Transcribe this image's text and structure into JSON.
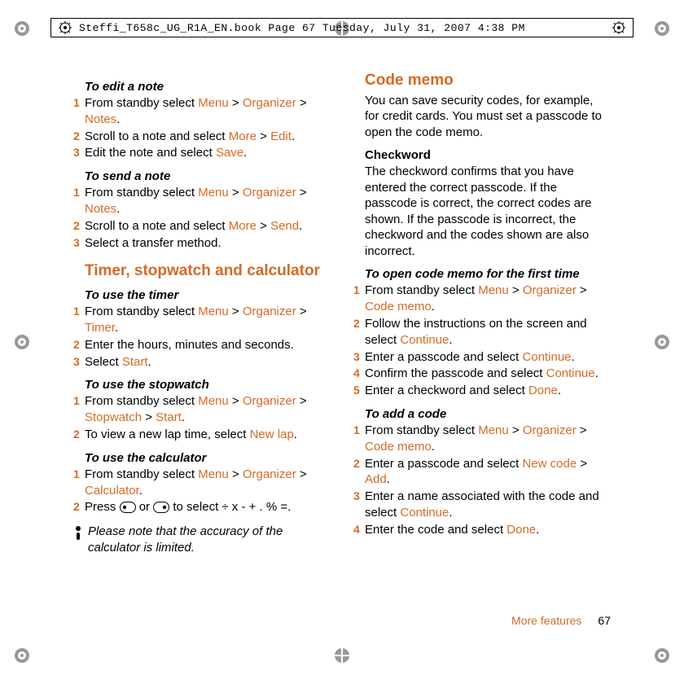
{
  "header": {
    "text": "Steffi_T658c_UG_R1A_EN.book  Page 67  Tuesday, July 31, 2007  4:38 PM"
  },
  "left": {
    "edit_note": {
      "title": "To edit a note",
      "s1a": "From standby select ",
      "s1_menu": "Menu",
      "s1_gt1": " > ",
      "s1_org": "Organizer",
      "s1_gt2": " > ",
      "s1_notes": "Notes",
      "s1_dot": ".",
      "s2a": "Scroll to a note and select ",
      "s2_more": "More",
      "s2_gt": " > ",
      "s2_edit": "Edit",
      "s2_dot": ".",
      "s3a": "Edit the note and select ",
      "s3_save": "Save",
      "s3_dot": "."
    },
    "send_note": {
      "title": "To send a note",
      "s1a": "From standby select ",
      "s1_menu": "Menu",
      "s1_gt1": " > ",
      "s1_org": "Organizer",
      "s1_gt2": " > ",
      "s1_notes": "Notes",
      "s1_dot": ".",
      "s2a": "Scroll to a note and select ",
      "s2_more": "More",
      "s2_gt": " > ",
      "s2_send": "Send",
      "s2_dot": ".",
      "s3": "Select a transfer method."
    },
    "section_tsc": "Timer, stopwatch and calculator",
    "timer": {
      "title": "To use the timer",
      "s1a": "From standby select ",
      "s1_menu": "Menu",
      "s1_gt1": " > ",
      "s1_org": "Organizer",
      "s1_gt2": " > ",
      "s1_timer": "Timer",
      "s1_dot": ".",
      "s2": "Enter the hours, minutes and seconds.",
      "s3a": "Select ",
      "s3_start": "Start",
      "s3_dot": "."
    },
    "stopwatch": {
      "title": "To use the stopwatch",
      "s1a": "From standby select ",
      "s1_menu": "Menu",
      "s1_gt1": " > ",
      "s1_org": "Organizer",
      "s1_gt2": " > ",
      "s1_sw": "Stopwatch",
      "s1_gt3": " > ",
      "s1_start": "Start",
      "s1_dot": ".",
      "s2a": "To view a new lap time, select ",
      "s2_newlap": "New lap",
      "s2_dot": "."
    },
    "calculator": {
      "title": "To use the calculator",
      "s1a": "From standby select ",
      "s1_menu": "Menu",
      "s1_gt1": " > ",
      "s1_org": "Organizer",
      "s1_gt2": " > ",
      "s1_calc": "Calculator",
      "s1_dot": ".",
      "s2a": "Press ",
      "s2_mid": " or ",
      "s2b": " to select ÷ x - + . % =."
    },
    "note": "Please note that the accuracy of the calculator is limited."
  },
  "right": {
    "section_code": "Code memo",
    "intro": "You can save security codes, for example, for credit cards. You must set a passcode to open the code memo.",
    "checkword_head": "Checkword",
    "checkword_body": "The checkword confirms that you have entered the correct passcode. If the passcode is correct, the correct codes are shown. If the passcode is incorrect, the checkword and the codes shown are also incorrect.",
    "open": {
      "title": "To open code memo for the first time",
      "s1a": "From standby select ",
      "s1_menu": "Menu",
      "s1_gt1": " > ",
      "s1_org": "Organizer",
      "s1_gt2": " > ",
      "s1_cm": "Code memo",
      "s1_dot": ".",
      "s2a": "Follow the instructions on the screen and select ",
      "s2_cont": "Continue",
      "s2_dot": ".",
      "s3a": "Enter a passcode and select ",
      "s3_cont": "Continue",
      "s3_dot": ".",
      "s4a": "Confirm the passcode and select ",
      "s4_cont": "Continue",
      "s4_dot": ".",
      "s5a": "Enter a checkword and select ",
      "s5_done": "Done",
      "s5_dot": "."
    },
    "add": {
      "title": "To add a code",
      "s1a": "From standby select ",
      "s1_menu": "Menu",
      "s1_gt1": " > ",
      "s1_org": "Organizer",
      "s1_gt2": " > ",
      "s1_cm": "Code memo",
      "s1_dot": ".",
      "s2a": "Enter a passcode and select ",
      "s2_nc": "New code",
      "s2_gt": " > ",
      "s2_add": "Add",
      "s2_dot": ".",
      "s3a": "Enter a name associated with the code and select ",
      "s3_cont": "Continue",
      "s3_dot": ".",
      "s4a": "Enter the code and select ",
      "s4_done": "Done",
      "s4_dot": "."
    }
  },
  "footer": {
    "label": "More features",
    "page": "67"
  }
}
